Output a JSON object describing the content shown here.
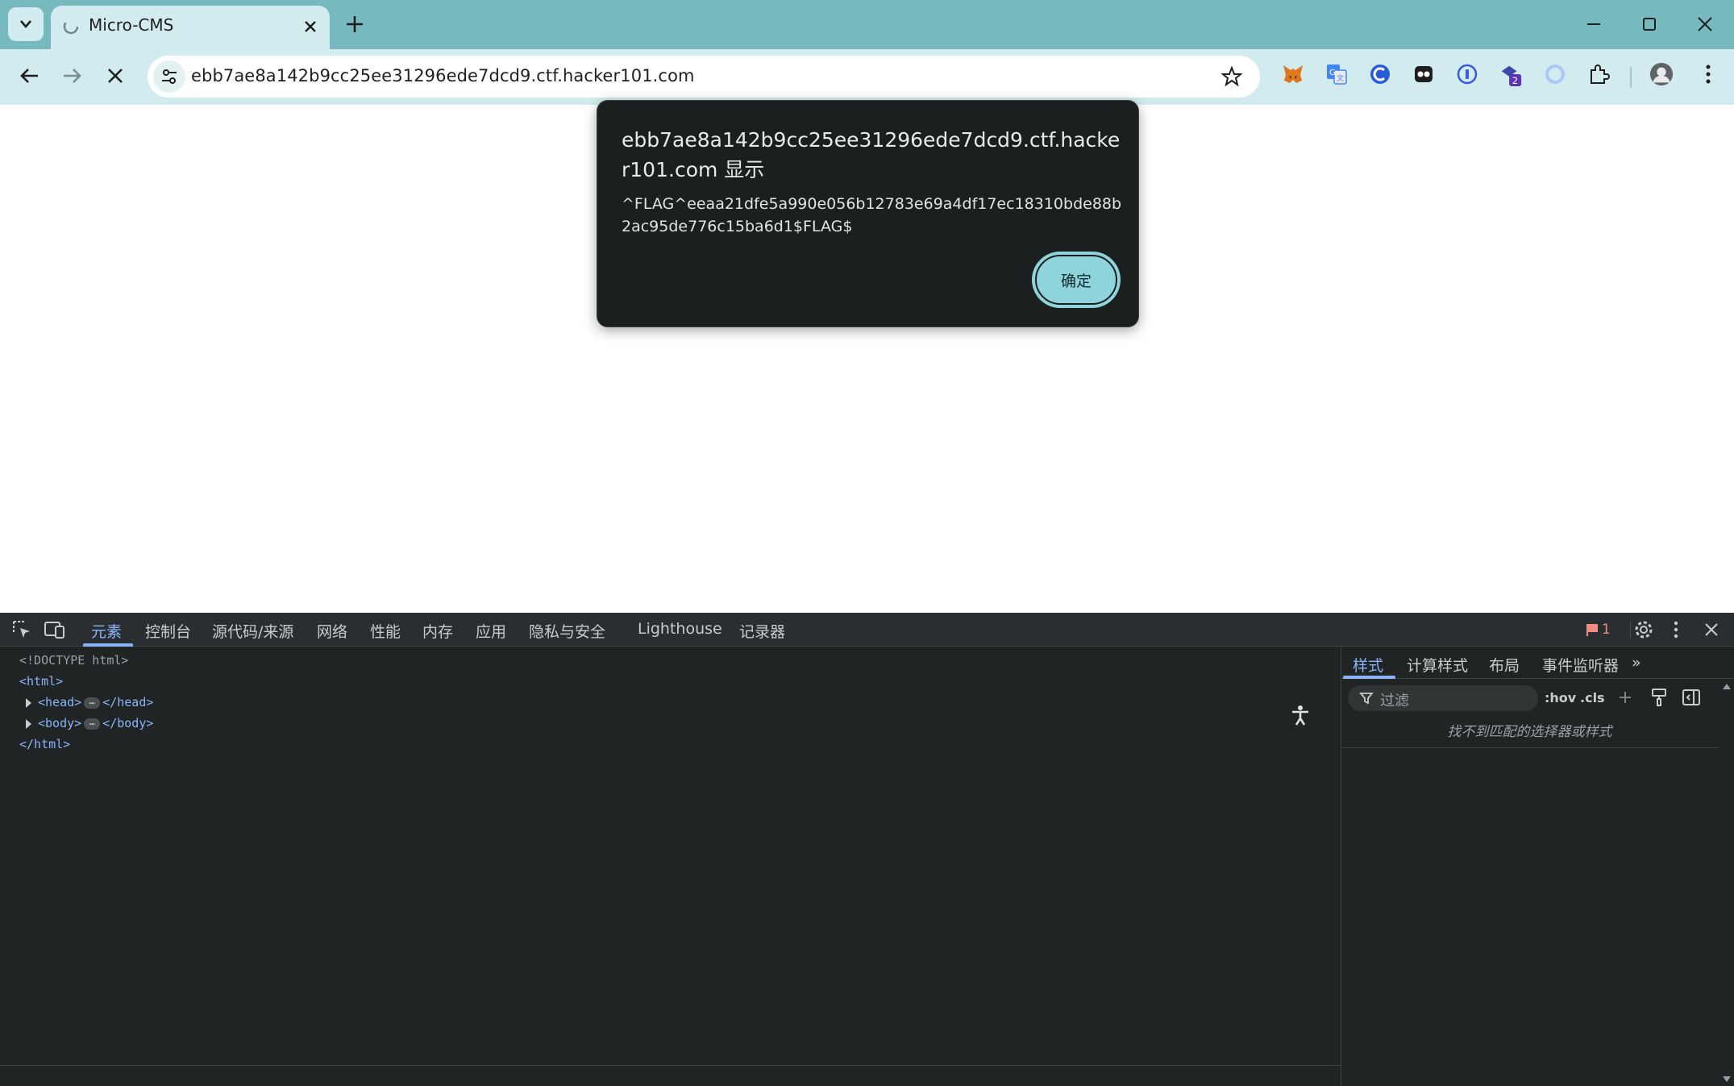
{
  "browser": {
    "tab_title": "Micro-CMS",
    "url": "ebb7ae8a142b9cc25ee31296ede7dcd9.ctf.hacker101.com",
    "profile_badge": "2"
  },
  "dialog": {
    "origin": "ebb7ae8a142b9cc25ee31296ede7dcd9.ctf.hacker101.com 显示",
    "message": "^FLAG^eeaa21dfe5a990e056b12783e69a4df17ec18310bde88b2ac95de776c15ba6d1$FLAG$",
    "ok_label": "确定"
  },
  "devtools": {
    "tabs": [
      "元素",
      "控制台",
      "源代码/来源",
      "网络",
      "性能",
      "内存",
      "应用",
      "隐私与安全",
      "Lighthouse",
      "记录器"
    ],
    "active_tab": "元素",
    "issues_count": "1",
    "dom": {
      "doctype": "<!DOCTYPE html>",
      "html_open": "<html>",
      "head_open": "<head>",
      "head_close": "</head>",
      "body_open": "<body>",
      "body_close": "</body>",
      "html_close": "</html>",
      "ellipsis": "…"
    },
    "styles_tabs": [
      "样式",
      "计算样式",
      "布局",
      "事件监听器"
    ],
    "more_tabs": "»",
    "filter_placeholder": "过滤",
    "hov_label": ":hov",
    "cls_label": ".cls",
    "no_match": "找不到匹配的选择器或样式"
  },
  "colors": {
    "titlebar": "#76b9bf",
    "toolbar": "#d2ebee",
    "dialog_bg": "#1b1f20",
    "accent_button": "#8fd4da",
    "devtools_bg": "#202425",
    "devtools_accent": "#8ab4f8"
  }
}
